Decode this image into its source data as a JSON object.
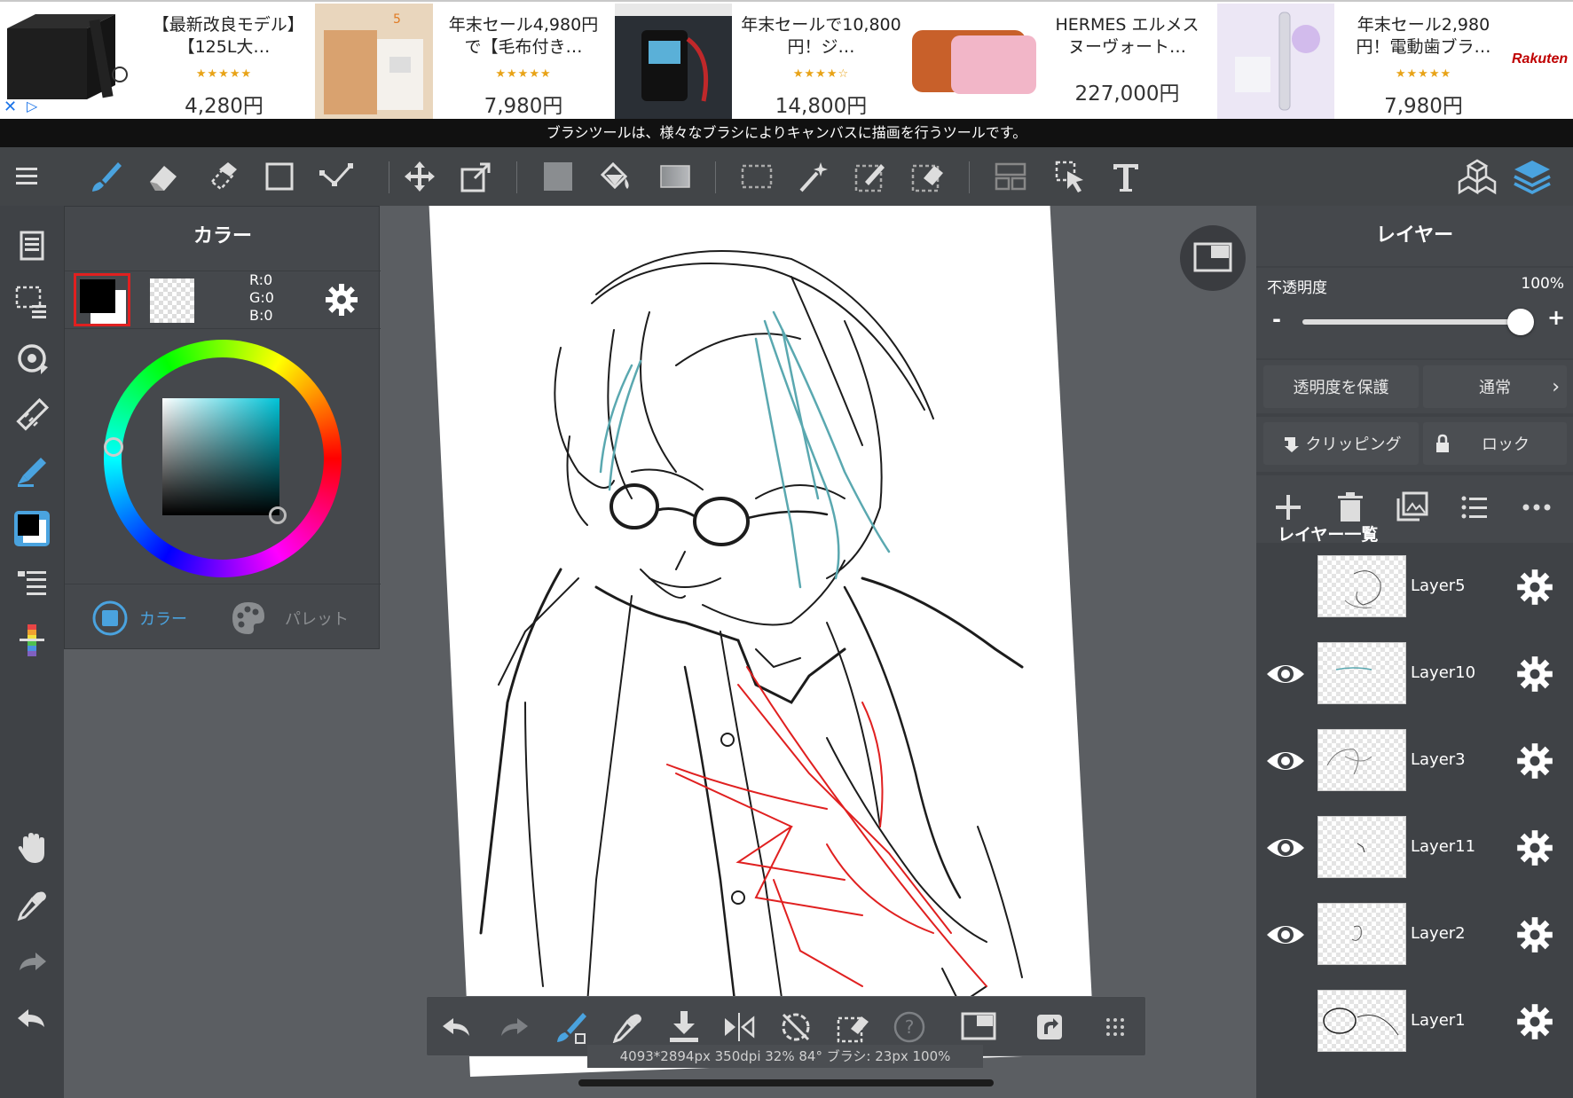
{
  "ads": [
    {
      "title": "【最新改良モデル】【125L大…",
      "stars": "★★★★★",
      "price": "4,280円"
    },
    {
      "title": "年末セール4,980円で【毛布付き…",
      "stars": "★★★★★",
      "price": "7,980円"
    },
    {
      "title": "年末セールで10,800円！ジ…",
      "stars": "★★★★☆",
      "price": "14,800円"
    },
    {
      "title": "HERMES エルメス ヌーヴォート…",
      "stars": "",
      "price": "227,000円"
    },
    {
      "title": "年末セール2,980円！電動歯ブラ…",
      "stars": "★★★★★",
      "price": "7,980円"
    }
  ],
  "ad_brand": "Rakuten",
  "tooltip": "ブラシツールは、様々なブラシによりキャンバスに描画を行うツールです。",
  "color_panel": {
    "title": "カラー",
    "r": "R:0",
    "g": "G:0",
    "b": "B:0",
    "tab_color": "カラー",
    "tab_palette": "パレット",
    "accent": "#4aa3df"
  },
  "layer_panel": {
    "title": "レイヤー",
    "opacity_label": "不透明度",
    "opacity_value": "100%",
    "opacity_fraction": 1.0,
    "minus": "-",
    "plus": "+",
    "protect_alpha": "透明度を保護",
    "blend_mode": "通常",
    "clipping": "クリッピング",
    "lock": "ロック",
    "list_label": "レイヤー一覧",
    "layers": [
      {
        "name": "Layer5",
        "visible": false
      },
      {
        "name": "Layer10",
        "visible": true
      },
      {
        "name": "Layer3",
        "visible": true
      },
      {
        "name": "Layer11",
        "visible": true
      },
      {
        "name": "Layer2",
        "visible": true
      },
      {
        "name": "Layer1",
        "visible": false
      }
    ]
  },
  "status": "4093*2894px 350dpi 32% 84° ブラシ: 23px 100%"
}
